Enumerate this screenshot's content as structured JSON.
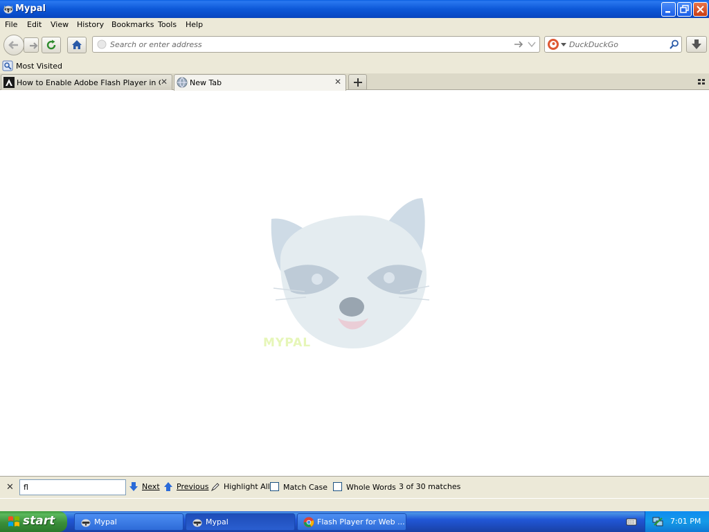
{
  "window": {
    "title": "Mypal"
  },
  "menu": [
    "File",
    "Edit",
    "View",
    "History",
    "Bookmarks",
    "Tools",
    "Help"
  ],
  "navbar": {
    "url_placeholder": "Search or enter address",
    "search_placeholder": "DuckDuckGo"
  },
  "bookmarks": [
    {
      "label": "Most Visited"
    }
  ],
  "tabs": [
    {
      "label": "How to Enable Adobe Flash Player in Goo...",
      "active": false
    },
    {
      "label": "New Tab",
      "active": true
    }
  ],
  "content": {
    "watermark": "mypal"
  },
  "findbar": {
    "query": "fl",
    "next_label": "Next",
    "previous_label": "Previous",
    "highlight_label": "Highlight All",
    "match_case_label": "Match Case",
    "whole_words_label": "Whole Words",
    "status": "3 of 30 matches"
  },
  "taskbar": {
    "start_label": "start",
    "tasks": [
      {
        "label": "Mypal",
        "active": false
      },
      {
        "label": "Mypal",
        "active": true
      },
      {
        "label": "Flash Player for Web ...",
        "active": false
      }
    ],
    "clock": "7:01 PM"
  },
  "colors": {
    "titlebar": "#0a5fe0",
    "chrome": "#ece9d8",
    "taskbar": "#2157d7",
    "start_button": "#3a8e3a",
    "close_button": "#c83c14"
  }
}
